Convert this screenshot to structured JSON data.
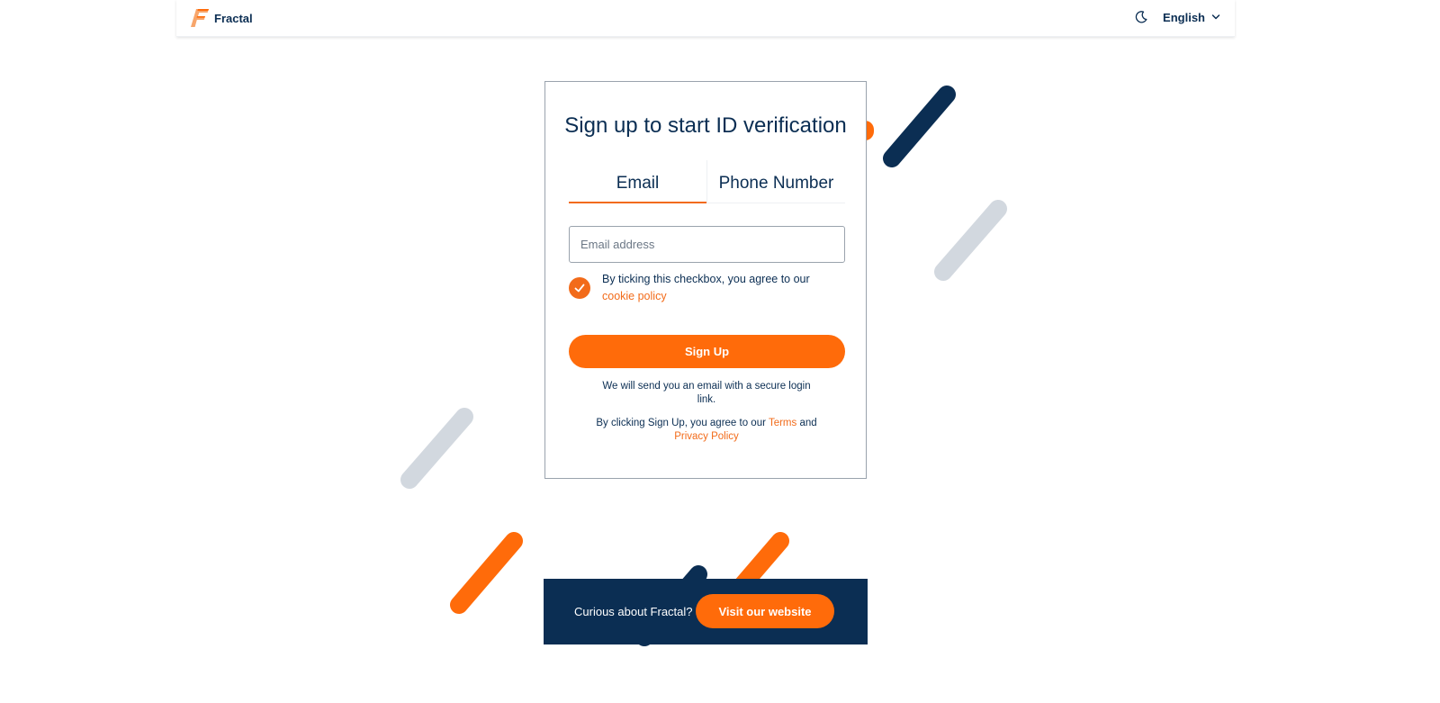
{
  "header": {
    "brand_name": "Fractal",
    "theme_icon": "moon-icon",
    "language": "English",
    "language_icon": "chevron-down-icon"
  },
  "signup": {
    "title": "Sign up to start ID verification",
    "tabs": [
      {
        "label": "Email",
        "active": true
      },
      {
        "label": "Phone Number",
        "active": false
      }
    ],
    "email_placeholder": "Email address",
    "email_value": "",
    "consent_checked": true,
    "consent_text": "By ticking this checkbox, you agree to our",
    "consent_link": "cookie policy",
    "button_label": "Sign Up",
    "note": "We will send you an email with a secure login link.",
    "terms_prefix": "By clicking Sign Up, you agree to our",
    "terms_link": "Terms",
    "terms_and": "and",
    "privacy_link": "Privacy Policy"
  },
  "banner": {
    "text": "Curious about Fractal?",
    "button_label": "Visit our website"
  },
  "colors": {
    "accent": "#ff6b0a",
    "navy": "#0b2e53",
    "decor_gray": "#d2d8df"
  }
}
